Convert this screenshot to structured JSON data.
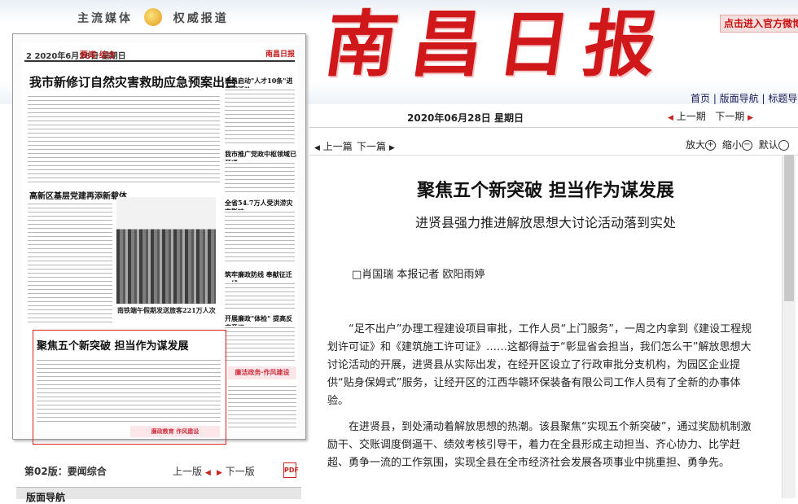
{
  "banner": {
    "slogan_left": "主流媒体",
    "slogan_right": "权威报道",
    "masthead": "南昌日报",
    "promo": "点击进入官方微博"
  },
  "toplinks": "首页 | 版面导航 | 标题导",
  "date": "2020年06月28日 星期日",
  "issue_nav": {
    "prev": "上一期",
    "next": "下一期"
  },
  "article_nav": {
    "prev": "上一篇",
    "next": "下一篇"
  },
  "zoom": {
    "in": "放大",
    "out": "缩小",
    "default": "默认"
  },
  "thumbnail": {
    "page_header": "2 2020年6月28日 星期日",
    "section_tag": "要闻·综合",
    "logo": "南昌日报",
    "headline_main": "我市新修订自然灾害救助应急预案出台",
    "side_headlines": [
      "南昌启动\"人才10条\"进校园活动",
      "我市推广党政中枢领域已开通",
      "全省54.7万人受洪涝灾害影响",
      "高新区基层党建再添新载体",
      "筑牢廉政防线 奉献征迁一线",
      "开展廉政\"体检\" 提高反腐意识"
    ],
    "photo_caption": "南铁端午假期发送旅客221万人次",
    "box_headline": "聚焦五个新突破 担当作为谋发展",
    "stamp1": "廉洁政务·作风建设",
    "stamp2": "廉政教育 作风建设"
  },
  "pagebar": {
    "edition": "第02版：要闻综合",
    "prev": "上一版",
    "next": "下一版",
    "pdf": "PDF"
  },
  "nav_strip": "版面导航",
  "article": {
    "headline": "聚焦五个新突破 担当作为谋发展",
    "subhead": "进贤县强力推进解放思想大讨论活动落到实处",
    "byline": "□肖国瑞 本报记者 欧阳雨婷",
    "paragraphs": [
      "“足不出户”办理工程建设项目审批，工作人员“上门服务”，一周之内拿到《建设工程规划许可证》和《建筑施工许可证》……这都得益于“彰显省会担当，我们怎么干”解放思想大讨论活动的开展，进贤县从实际出发，在经开区设立了行政审批分支机构，为园区企业提供“贴身保姆式”服务，让经开区的江西华赣环保装备有限公司工作人员有了全新的办事体验。",
      "在进贤县，到处涌动着解放思想的热潮。该县聚焦“实现五个新突破”，通过奖励机制激励干、交账调度倒逼干、绩效考核引导干，着力在全县形成主动担当、齐心协力、比学赶超、勇争一流的工作氛围，实现全县在全市经济社会发展各项事业中挑重担、勇争先。"
    ]
  }
}
